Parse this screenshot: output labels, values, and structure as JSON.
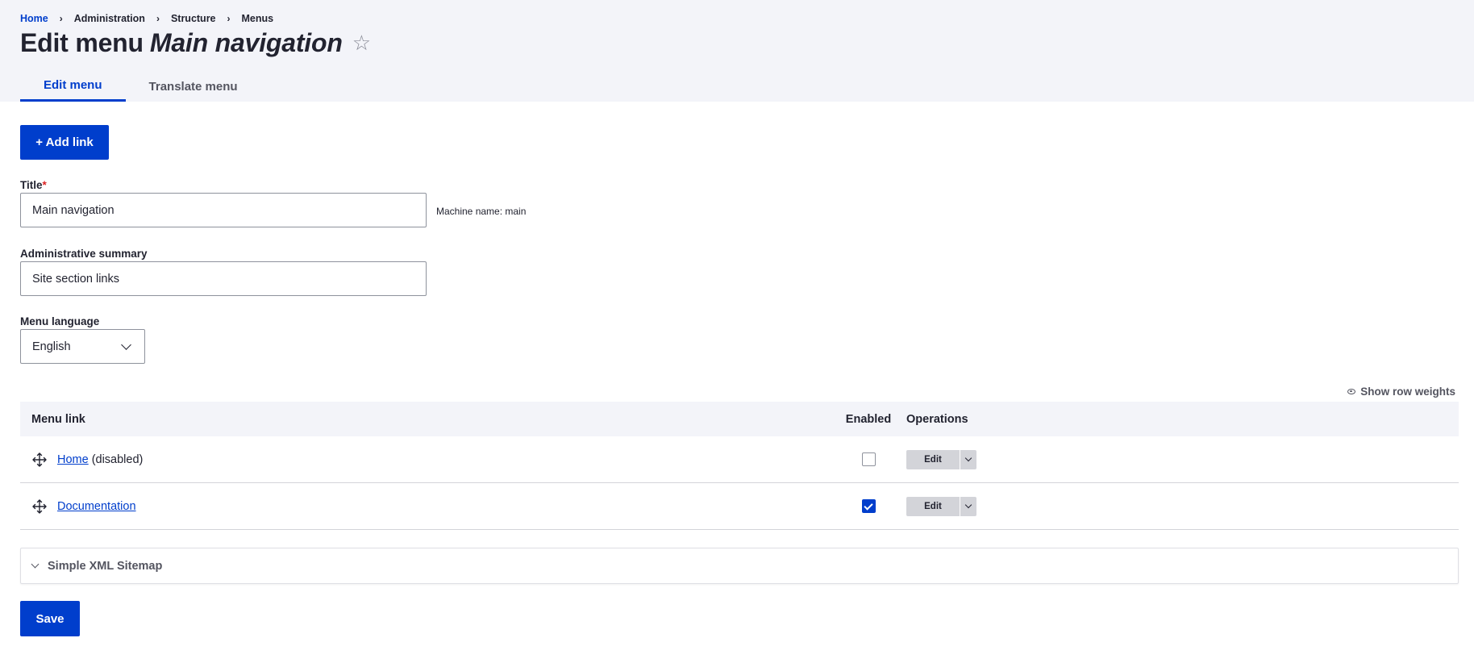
{
  "breadcrumb": [
    "Home",
    "Administration",
    "Structure",
    "Menus"
  ],
  "breadcrumb_separator": "›",
  "page": {
    "title_prefix": "Edit menu",
    "title_name": "Main navigation",
    "favorite_icon": "star-outline-icon"
  },
  "tabs": [
    {
      "label": "Edit menu",
      "active": true
    },
    {
      "label": "Translate menu",
      "active": false
    }
  ],
  "add_link_label": "+ Add link",
  "form": {
    "title_label": "Title",
    "required_mark": "*",
    "title_value": "Main navigation",
    "machine_name": "Machine name: main",
    "summary_label": "Administrative summary",
    "summary_value": "Site section links",
    "language_label": "Menu language",
    "language_value": "English"
  },
  "show_row_weights": "Show row weights",
  "table": {
    "headers": [
      "Menu link",
      "Enabled",
      "Operations"
    ],
    "rows": [
      {
        "link": "Home",
        "suffix": "(disabled)",
        "enabled": false,
        "operation": "Edit"
      },
      {
        "link": "Documentation",
        "suffix": "",
        "enabled": true,
        "operation": "Edit"
      }
    ]
  },
  "details_summary": "Simple XML Sitemap",
  "save_label": "Save",
  "colors": {
    "accent": "#003ecc",
    "header_bg": "#f3f4f9",
    "required": "#dc2323"
  }
}
